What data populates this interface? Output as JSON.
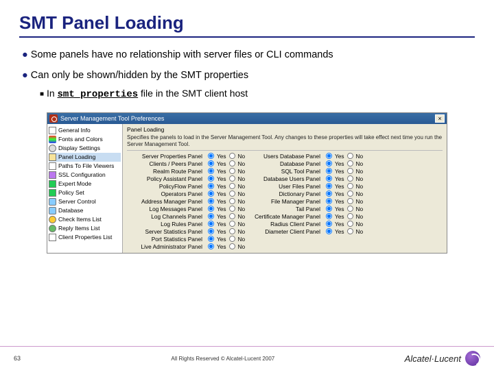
{
  "title": "SMT Panel Loading",
  "bullets": {
    "b1a": "Some panels have no relationship with server files or CLI commands",
    "b1b": "Can only be shown/hidden by the SMT properties",
    "b2_pre": "In ",
    "b2_code": "smt_properties",
    "b2_post": " file in the SMT client host"
  },
  "dialog": {
    "title": "Server Management Tool Preferences",
    "tree": [
      {
        "icon": "doc",
        "label": "General Info"
      },
      {
        "icon": "col",
        "label": "Fonts and Colors"
      },
      {
        "icon": "gear",
        "label": "Display Settings"
      },
      {
        "icon": "fold",
        "label": "Panel Loading"
      },
      {
        "icon": "doc",
        "label": "Paths To File Viewers"
      },
      {
        "icon": "key",
        "label": "SSL Configuration"
      },
      {
        "icon": "shield",
        "label": "Expert Mode"
      },
      {
        "icon": "shield",
        "label": "Policy Set"
      },
      {
        "icon": "db",
        "label": "Server Control"
      },
      {
        "icon": "db",
        "label": "Database"
      },
      {
        "icon": "star",
        "label": "Check Items List"
      },
      {
        "icon": "ball",
        "label": "Reply Items List"
      },
      {
        "icon": "list",
        "label": "Client Properties List"
      }
    ],
    "pane_header": "Panel Loading",
    "description": "Specifies the panels to load in the Server Management Tool. Any changes to these properties will take effect next time you run the Server Management Tool.",
    "yes": "Yes",
    "no": "No",
    "rows": [
      {
        "l": "Server Properties Panel",
        "r": "Users Database Panel",
        "ls": "y",
        "rs": "y"
      },
      {
        "l": "Clients / Peers Panel",
        "r": "Database Panel",
        "ls": "y",
        "rs": "y"
      },
      {
        "l": "Realm Route Panel",
        "r": "SQL Tool Panel",
        "ls": "y",
        "rs": "y"
      },
      {
        "l": "Policy Assistant Panel",
        "r": "Database Users Panel",
        "ls": "y",
        "rs": "y"
      },
      {
        "l": "PolicyFlow Panel",
        "r": "User Files Panel",
        "ls": "y",
        "rs": "y"
      },
      {
        "l": "Operators Panel",
        "r": "Dictionary Panel",
        "ls": "y",
        "rs": "y"
      },
      {
        "l": "Address Manager Panel",
        "r": "File Manager Panel",
        "ls": "y",
        "rs": "y"
      },
      {
        "l": "Log Messages Panel",
        "r": "Tail Panel",
        "ls": "y",
        "rs": "y"
      },
      {
        "l": "Log Channels Panel",
        "r": "Certificate Manager Panel",
        "ls": "y",
        "rs": "y"
      },
      {
        "l": "Log Rules Panel",
        "r": "Radius Client Panel",
        "ls": "y",
        "rs": "y"
      },
      {
        "l": "Server Statistics Panel",
        "r": "Diameter Client Panel",
        "ls": "y",
        "rs": "y"
      },
      {
        "l": "Port Statistics Panel",
        "r": "",
        "ls": "y",
        "rs": ""
      },
      {
        "l": "Live Administrator Panel",
        "r": "",
        "ls": "y",
        "rs": ""
      }
    ]
  },
  "footer": {
    "page": "63",
    "copyright": "All Rights Reserved © Alcatel-Lucent 2007",
    "brand": "Alcatel·Lucent"
  }
}
